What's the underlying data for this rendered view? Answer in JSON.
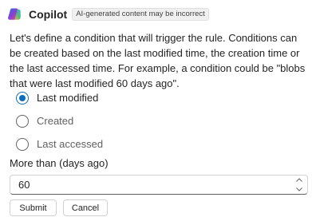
{
  "header": {
    "app_name": "Copilot",
    "logo_icon": "copilot-logo-icon",
    "ai_badge": "AI-generated content may be incorrect"
  },
  "message": {
    "text": "Let's define a condition that will trigger the rule. Conditions can be created based on the last modified time, the creation time or the last accessed time. For example, a condition could be \"blobs that were last modified 60 days ago\"."
  },
  "condition_options": [
    {
      "label": "Last modified",
      "selected": true
    },
    {
      "label": "Created",
      "selected": false
    },
    {
      "label": "Last accessed",
      "selected": false
    }
  ],
  "days_field": {
    "label": "More than (days ago)",
    "value": "60"
  },
  "buttons": {
    "submit_label": "Submit",
    "cancel_label": "Cancel"
  },
  "colors": {
    "accent": "#0f6cbd",
    "text": "#242424",
    "border": "#d1d1d1"
  }
}
